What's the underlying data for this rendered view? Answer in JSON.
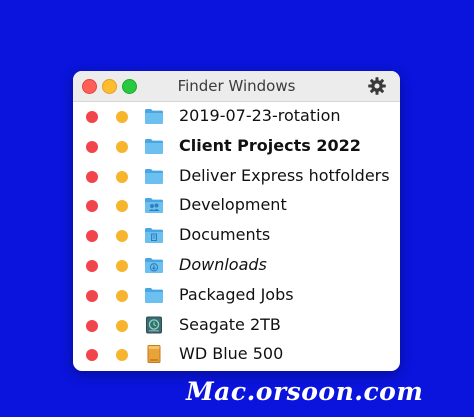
{
  "window": {
    "title": "Finder Windows"
  },
  "items": [
    {
      "label": "2019-07-23-rotation",
      "icon": "folder-icon",
      "style": "normal"
    },
    {
      "label": "Client Projects 2022",
      "icon": "folder-icon",
      "style": "bold"
    },
    {
      "label": "Deliver Express hotfolders",
      "icon": "folder-icon",
      "style": "normal"
    },
    {
      "label": "Development",
      "icon": "shared-folder-icon",
      "style": "normal"
    },
    {
      "label": "Documents",
      "icon": "documents-folder-icon",
      "style": "normal"
    },
    {
      "label": "Downloads",
      "icon": "downloads-folder-icon",
      "style": "italic"
    },
    {
      "label": "Packaged Jobs",
      "icon": "folder-icon",
      "style": "normal"
    },
    {
      "label": "Seagate 2TB",
      "icon": "time-machine-drive-icon",
      "style": "normal"
    },
    {
      "label": "WD Blue 500",
      "icon": "external-drive-icon",
      "style": "normal"
    }
  ],
  "watermark": "Mac.orsoon.com",
  "colors": {
    "background": "#0a14dc",
    "close": "#f2444b",
    "minimize": "#f7b52d",
    "zoom": "#28c840",
    "folder": "#5ab4ec"
  }
}
